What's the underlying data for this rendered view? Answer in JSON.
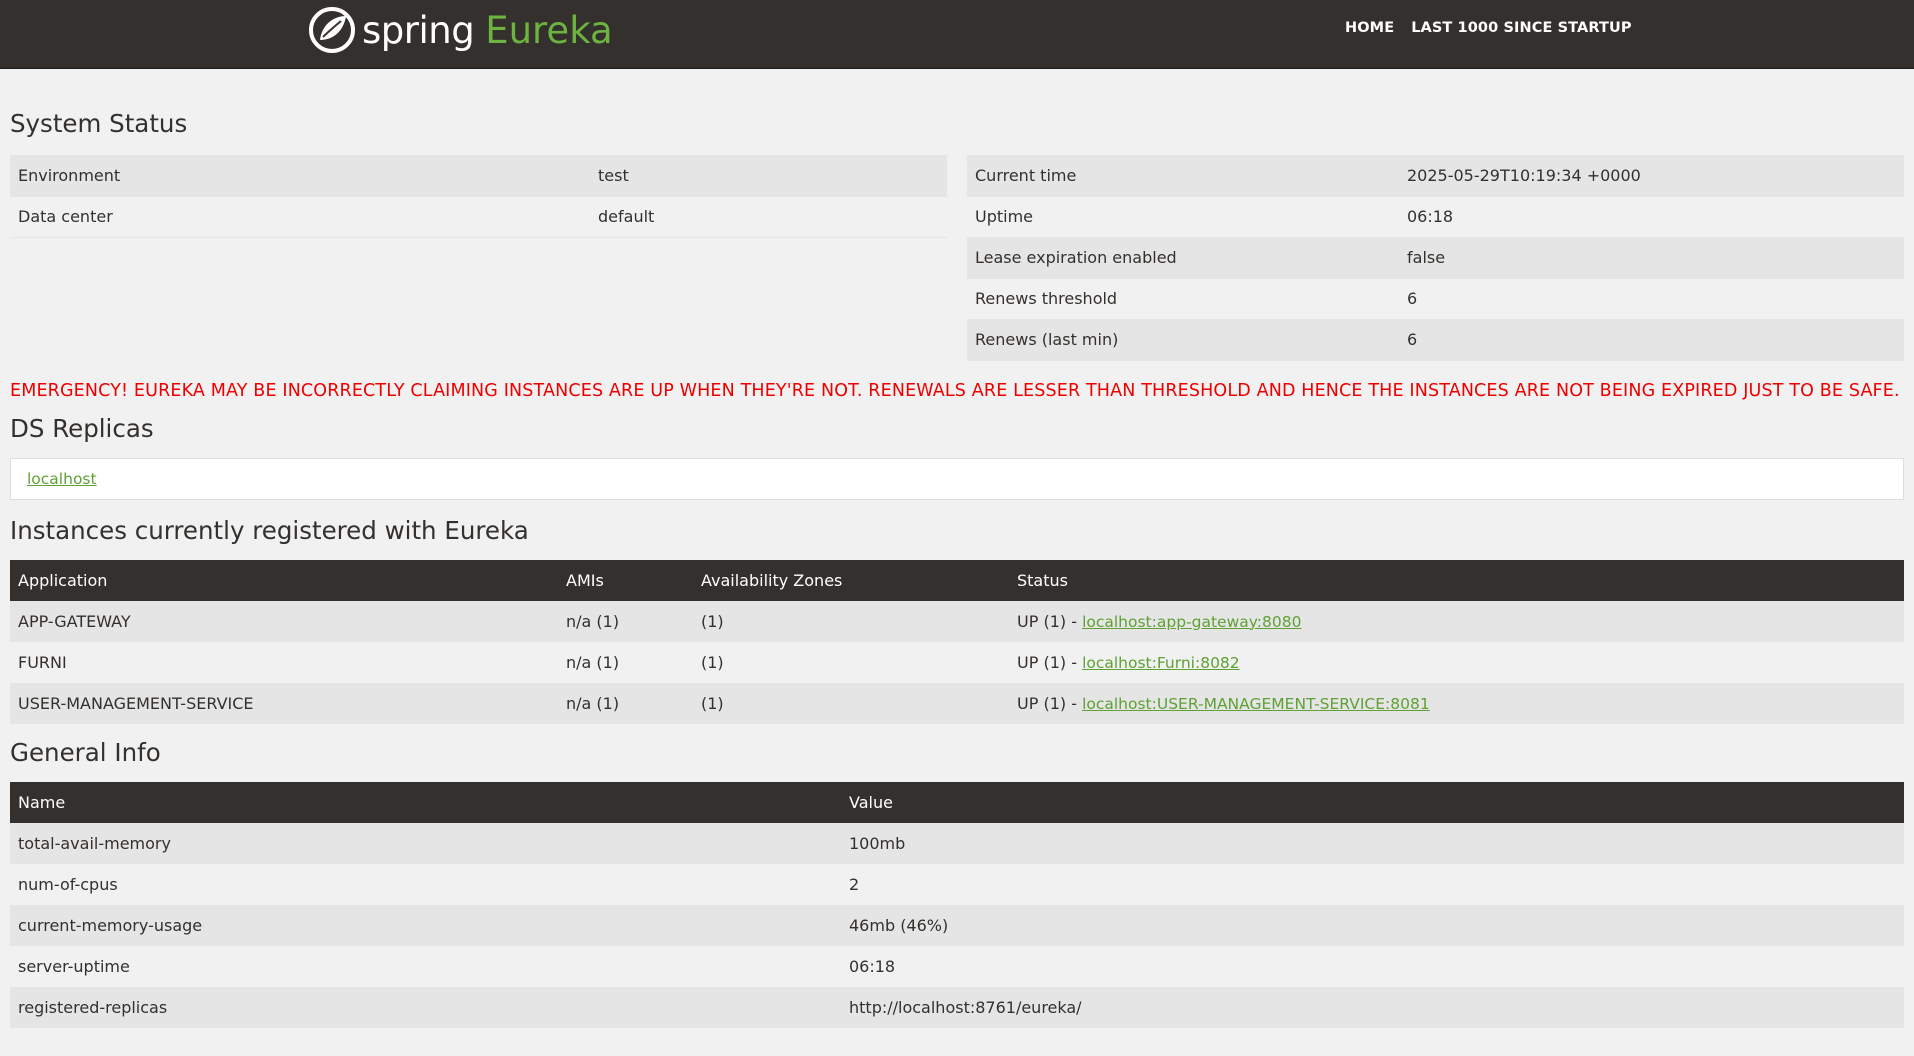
{
  "navbar": {
    "brand_spring": "spring",
    "brand_eureka": "Eureka",
    "links": [
      {
        "label": "HOME"
      },
      {
        "label": "LAST 1000 SINCE STARTUP"
      }
    ]
  },
  "system_status": {
    "title": "System Status",
    "left": [
      {
        "label": "Environment",
        "value": "test"
      },
      {
        "label": "Data center",
        "value": "default"
      }
    ],
    "right": [
      {
        "label": "Current time",
        "value": "2025-05-29T10:19:34 +0000"
      },
      {
        "label": "Uptime",
        "value": "06:18"
      },
      {
        "label": "Lease expiration enabled",
        "value": "false"
      },
      {
        "label": "Renews threshold",
        "value": "6"
      },
      {
        "label": "Renews (last min)",
        "value": "6"
      }
    ]
  },
  "emergency": "EMERGENCY! EUREKA MAY BE INCORRECTLY CLAIMING INSTANCES ARE UP WHEN THEY'RE NOT. RENEWALS ARE LESSER THAN THRESHOLD AND HENCE THE INSTANCES ARE NOT BEING EXPIRED JUST TO BE SAFE.",
  "ds_replicas": {
    "title": "DS Replicas",
    "items": [
      "localhost"
    ]
  },
  "instances": {
    "title": "Instances currently registered with Eureka",
    "headers": [
      "Application",
      "AMIs",
      "Availability Zones",
      "Status"
    ],
    "rows": [
      {
        "application": "APP-GATEWAY",
        "amis": "n/a (1)",
        "zones": "(1)",
        "status_prefix": "UP (1) - ",
        "status_link": "localhost:app-gateway:8080"
      },
      {
        "application": "FURNI",
        "amis": "n/a (1)",
        "zones": "(1)",
        "status_prefix": "UP (1) - ",
        "status_link": "localhost:Furni:8082"
      },
      {
        "application": "USER-MANAGEMENT-SERVICE",
        "amis": "n/a (1)",
        "zones": "(1)",
        "status_prefix": "UP (1) - ",
        "status_link": "localhost:USER-MANAGEMENT-SERVICE:8081"
      }
    ]
  },
  "general_info": {
    "title": "General Info",
    "headers": [
      "Name",
      "Value"
    ],
    "rows": [
      {
        "name": "total-avail-memory",
        "value": "100mb"
      },
      {
        "name": "num-of-cpus",
        "value": "2"
      },
      {
        "name": "current-memory-usage",
        "value": "46mb (46%)"
      },
      {
        "name": "server-uptime",
        "value": "06:18"
      },
      {
        "name": "registered-replicas",
        "value": "http://localhost:8761/eureka/"
      }
    ]
  },
  "colors": {
    "navbar_bg": "#34302d",
    "brand_green": "#6db33f",
    "link_green": "#5fa134",
    "emergency_red": "#ee0000",
    "row_stripe": "#e5e5e5",
    "page_bg": "#f1f1f1"
  }
}
